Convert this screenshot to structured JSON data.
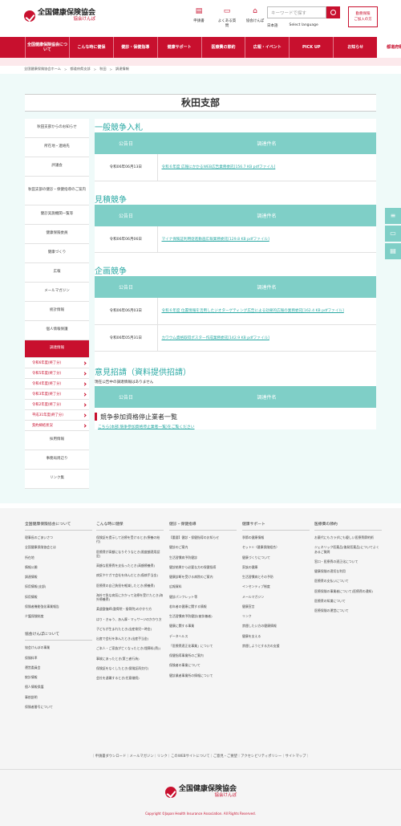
{
  "header": {
    "logo_main": "全国健康保険協会",
    "logo_sub": "協会けんぽ",
    "icons": [
      {
        "label": "申請書",
        "icon": "document-icon"
      },
      {
        "label": "よくある質問",
        "icon": "chat-icon"
      },
      {
        "label": "協会けんぽ",
        "icon": "building-icon"
      }
    ],
    "search_placeholder": "キーワードで探す",
    "lang": "日本語",
    "select_language": "Select language",
    "join_button": "勤務保険\nご加入の方"
  },
  "nav": {
    "items": [
      "全国健康保険協会について",
      "こんな時に健保",
      "健診・保健指導",
      "健康サポート",
      "医療費の節約",
      "広報・イベント",
      "PICK UP",
      "お知らせ",
      "都道府県支部"
    ],
    "active_index": 8
  },
  "breadcrumb": [
    "全国健康保険協会ホーム",
    "都道府県支部",
    "秋田",
    "調達情報"
  ],
  "page_title": "秋田支部",
  "sidebar": {
    "items": [
      "秋田支部からのお知らせ",
      "所在地・連絡先",
      "評議会",
      "秋田支部の健診・保健指導のご案内",
      "健診実施機関一覧等",
      "健康保険委員",
      "健康づくり",
      "広報",
      "メールマガジン",
      "統計情報",
      "個人情報保護",
      "調達情報"
    ],
    "sub_items": [
      "令和6年度(終了分)",
      "令和5年度(終了分)",
      "令和4年度(終了分)",
      "令和3年度(終了分)",
      "令和2年度(終了分)",
      "平成31年度(終了分)",
      "契約締結状況"
    ],
    "after_items": [
      "採用情報",
      "事務局周辺り",
      "リンク集"
    ]
  },
  "content": {
    "sections": [
      {
        "title": "一般競争入札",
        "header_date": "公告日",
        "header_name": "調達件名",
        "rows": [
          {
            "date": "令和06年06月13日",
            "name": "令和６年度 広報にかかるWEB広告業務委託[156.7 KB pdfファイル]"
          }
        ]
      },
      {
        "title": "見積競争",
        "header_date": "公告日",
        "header_name": "調達件名",
        "rows": [
          {
            "date": "令和06年06月06日",
            "name": "マイナ保険証利用促進動画広報業務委託[129.8 KB pdfファイル]"
          }
        ]
      },
      {
        "title": "企画競争",
        "header_date": "公告日",
        "header_name": "調達件名",
        "rows": [
          {
            "date": "令和06年06月03日",
            "name": "令和６年度 位置情報を活用したジオターゲティング広告による効果的広報の業務委託[162.4 KB pdfファイル]"
          },
          {
            "date": "令和06年05月31日",
            "name": "カワウム資格取得ポスター作成業務委託[142.9 KB pdfファイル]"
          }
        ]
      },
      {
        "title": "意見招請（資料提供招請）",
        "notice": "現在公告中の調達情報はありません",
        "header_date": "公告日",
        "header_name": "調達件名"
      }
    ],
    "suspend_title": "競争参加資格停止業者一覧",
    "suspend_link": "こちら(本部:競争参加資格停止業者一覧)をご覧ください"
  },
  "float_buttons": [
    "list-icon",
    "chat-icon",
    "document-icon"
  ],
  "footer": {
    "columns": [
      {
        "heading": "全国健康保険協会について",
        "links": [
          "理事長のごあいさつ",
          "全国健康保険協会とは",
          "所在地",
          "情報公開",
          "調達情報",
          "採用情報(支部)",
          "採用情報",
          "保険者機能強化事業報告",
          "介護保険制度"
        ],
        "heading2": "協会けんぽについて",
        "links2": [
          "協会けんぽの事業",
          "保険料率",
          "運営委員会",
          "統計情報",
          "個人情報保護",
          "事前説明",
          "保険者番号について"
        ]
      },
      {
        "heading": "こんな時に健保",
        "links": [
          "保険証を提示して治療を受けるとき(療養の給付)",
          "医療費が高額になりそうなとき(限度額適用認定)",
          "高額な医療費を支払ったとき(高額療養費)",
          "病気やケガで会社を休んだとき(傷病手当金)",
          "医療費の自己負担を軽減したとき(療養費)",
          "海外で急な病気にかかって治療を受けたとき(海外療養費)",
          "柔道整復師(整骨院・接骨院)のかかり方",
          "はり・きゅう、あん摩・マッサージのかかり方",
          "子どもが生まれたとき(出産育児一時金)",
          "出産で会社を休んだとき(出産手当金)",
          "ご本人・ご家族が亡くなったとき(埋葬料(費))",
          "事故にあったとき(第三者行為)",
          "保険証をなくしたとき(保険証再交付)",
          "会社を退職するとき(任意継続)"
        ]
      },
      {
        "heading": "健診・保健指導",
        "links": [
          "【重要】健診・保健指導のお知らせ",
          "健診のご案内",
          "生活習慣病予防健診",
          "健診結果から必要な方の保健指導",
          "健康診断を受ける病院のご案内",
          "広報資料",
          "健診パンフレット等",
          "若年者の健康に関する情報",
          "生活習慣病予防健診(被扶養者)",
          "健康に関する事業",
          "データヘルス",
          "「医療費適正化事業」について",
          "保健指導事業所のご案内",
          "保険者の事業について",
          "健診業者事業所の情報について"
        ]
      },
      {
        "heading": "健康サポート",
        "links": [
          "季節の健康情報",
          "セット!!〈健康保険組合〉",
          "健康づくりについて",
          "家族の健康",
          "生活習慣病とその予防",
          "インセンティブ制度",
          "メールマガジン",
          "健康宣言",
          "リンク",
          "禁煙したい方の健康情報",
          "健康を支える",
          "禁煙しようとする方の支援"
        ]
      },
      {
        "heading": "医療費の節約",
        "links": [
          "お薬代にもカラダにも優しい医療費節約術",
          "ジェネリック医薬品(後発医薬品)についてよくあるご質問",
          "窓口・医療費の適正化について",
          "健康保険の適切な利用",
          "医療費の支払いについて",
          "医療保険の事業者について(医療費の通知)",
          "医療費の知識について",
          "医療保険の運営について"
        ]
      }
    ],
    "bottom_links": "｜申請書ダウンロード｜メールマガジン｜リンク｜このWEBサイトについて｜ご意見・ご要望｜アクセシビリティポリシー｜サイトマップ｜",
    "logo_main": "全国健康保険協会",
    "logo_sub": "協会けんぽ",
    "copyright": "Copyright ©Japan Health Insurance Association. All Rights Reserved."
  }
}
